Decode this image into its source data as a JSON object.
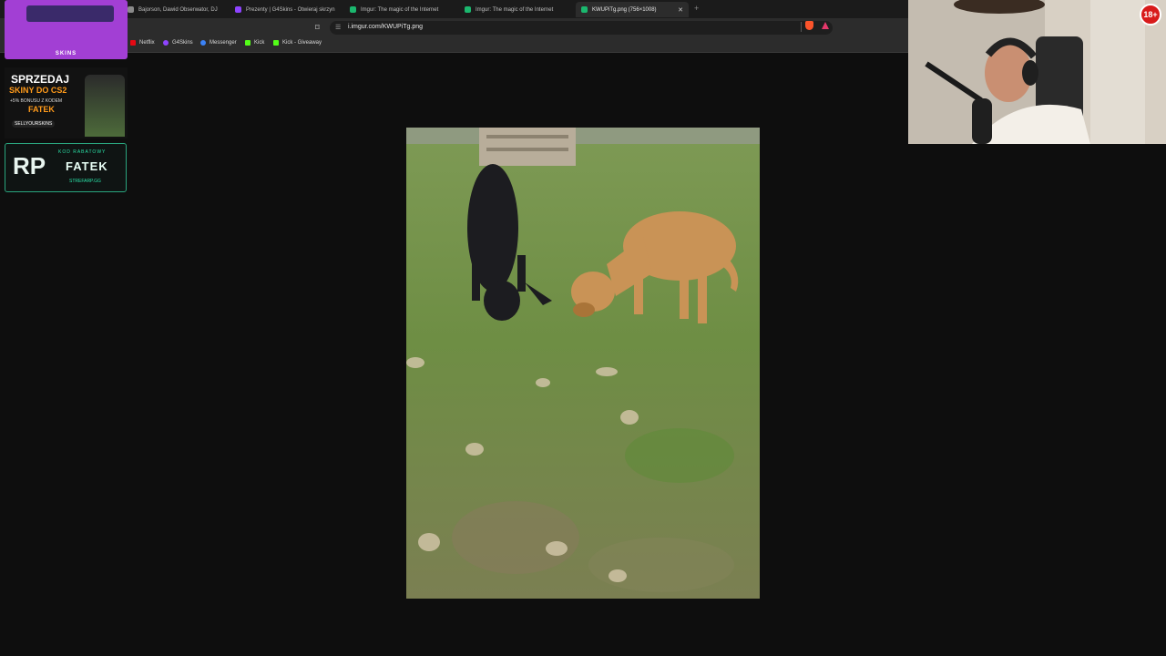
{
  "browser": {
    "tabs": [
      {
        "label": "Bajorson, Dawid Obserwator, DJ",
        "favicon": "#8a8a8a",
        "active": false
      },
      {
        "label": "Prezenty | G4Skins - Otwieraj skrzyn",
        "favicon": "#8e44ff",
        "active": false
      },
      {
        "label": "Imgur: The magic of the Internet",
        "favicon": "#1bb76e",
        "active": false
      },
      {
        "label": "Imgur: The magic of the Internet",
        "favicon": "#1bb76e",
        "active": false
      },
      {
        "label": "KWUPiTg.png (756×1008)",
        "favicon": "#1bb76e",
        "active": true
      }
    ],
    "url": "i.imgur.com/KWUPiTg.png",
    "bookmarks": [
      {
        "label": "Netflix",
        "icon": "#e50914"
      },
      {
        "label": "G4Skins",
        "icon": "#8e44ff"
      },
      {
        "label": "Messenger",
        "icon": "#3b82f6"
      },
      {
        "label": "Kick",
        "icon": "#53fc18"
      },
      {
        "label": "Kick - Giveaway",
        "icon": "#53fc18"
      }
    ]
  },
  "overlays": {
    "promo1_logo": "SKINS",
    "promo2": {
      "line1": "SPRZEDAJ",
      "line2": "SKINY DO CS2",
      "line3": "+5% BONUSU Z KODEM",
      "code": "FATEK",
      "brand": "SELLYOURSKINS"
    },
    "promo3": {
      "monogram": "RP",
      "label": "KOD RABATOWY",
      "code": "FATEK",
      "site": "STREFARP.GG"
    },
    "age_badge": "18+"
  },
  "colors": {
    "accent_purple": "#a23fd4",
    "accent_orange": "#ff9a1a",
    "accent_green": "#2ae3a8"
  }
}
